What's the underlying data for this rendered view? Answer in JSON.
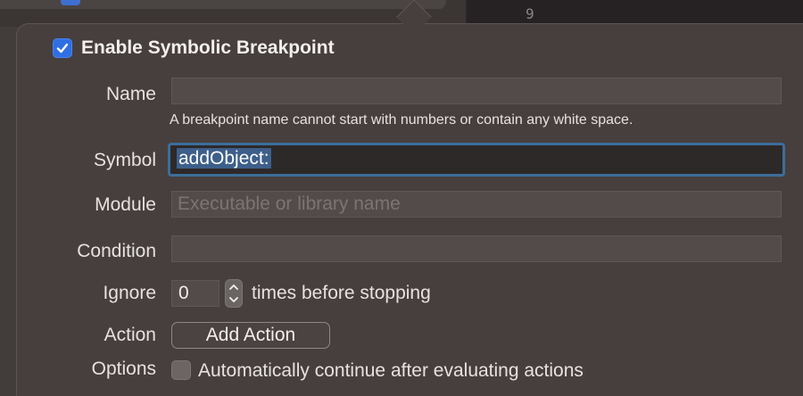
{
  "background": {
    "line_number": "9"
  },
  "breakpoint": {
    "enabled": true,
    "title": "Enable Symbolic Breakpoint"
  },
  "fields": {
    "name": {
      "label": "Name",
      "value": "",
      "hint": "A breakpoint name cannot start with numbers or contain any white space."
    },
    "symbol": {
      "label": "Symbol",
      "value": "addObject:"
    },
    "module": {
      "label": "Module",
      "value": "",
      "placeholder": "Executable or library name"
    },
    "condition": {
      "label": "Condition",
      "value": ""
    },
    "ignore": {
      "label": "Ignore",
      "value": "0",
      "suffix": "times before stopping"
    },
    "action": {
      "label": "Action",
      "button_label": "Add Action"
    },
    "options": {
      "label": "Options",
      "checkbox_checked": false,
      "checkbox_label": "Automatically continue after evaluating actions"
    }
  },
  "colors": {
    "accent": "#2f6fe4",
    "focus_ring": "#3c6e9a",
    "selection": "#3d5f8a",
    "popover_bg": "#463f3e"
  }
}
